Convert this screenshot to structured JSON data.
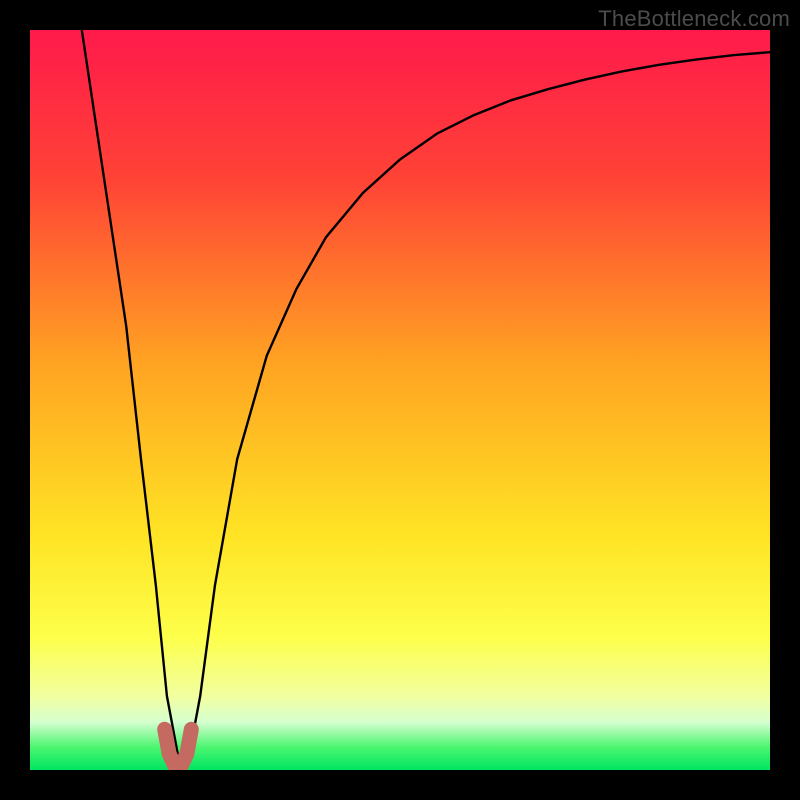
{
  "watermark": "TheBottleneck.com",
  "chart_data": {
    "type": "line",
    "title": "",
    "xlabel": "",
    "ylabel": "",
    "xlim": [
      0,
      100
    ],
    "ylim": [
      0,
      100
    ],
    "series": [
      {
        "name": "bottleneck-curve",
        "x": [
          7,
          10,
          13,
          15,
          17,
          18.5,
          20,
          21.5,
          23,
          25,
          28,
          32,
          36,
          40,
          45,
          50,
          55,
          60,
          65,
          70,
          75,
          80,
          85,
          90,
          95,
          100
        ],
        "values": [
          100,
          80,
          60,
          42,
          25,
          10,
          2,
          2,
          10,
          25,
          42,
          56,
          65,
          72,
          78,
          82.5,
          86,
          88.5,
          90.5,
          92,
          93.3,
          94.4,
          95.3,
          96,
          96.6,
          97
        ]
      },
      {
        "name": "optimal-marker",
        "x": [
          18.2,
          18.8,
          19.5,
          20,
          20.5,
          21.2,
          21.8
        ],
        "values": [
          5.5,
          2.2,
          0.7,
          0.5,
          0.7,
          2.2,
          5.5
        ]
      }
    ],
    "colors": {
      "curve": "#000000",
      "marker": "#c46a60",
      "gradient_stops": [
        {
          "offset": 0.0,
          "color": "#ff1a4b"
        },
        {
          "offset": 0.2,
          "color": "#ff4236"
        },
        {
          "offset": 0.45,
          "color": "#ffa322"
        },
        {
          "offset": 0.68,
          "color": "#ffe324"
        },
        {
          "offset": 0.82,
          "color": "#fdff4a"
        },
        {
          "offset": 0.9,
          "color": "#f2ffa0"
        },
        {
          "offset": 0.935,
          "color": "#d6ffcf"
        },
        {
          "offset": 0.97,
          "color": "#49f56f"
        },
        {
          "offset": 1.0,
          "color": "#00e561"
        }
      ]
    }
  }
}
